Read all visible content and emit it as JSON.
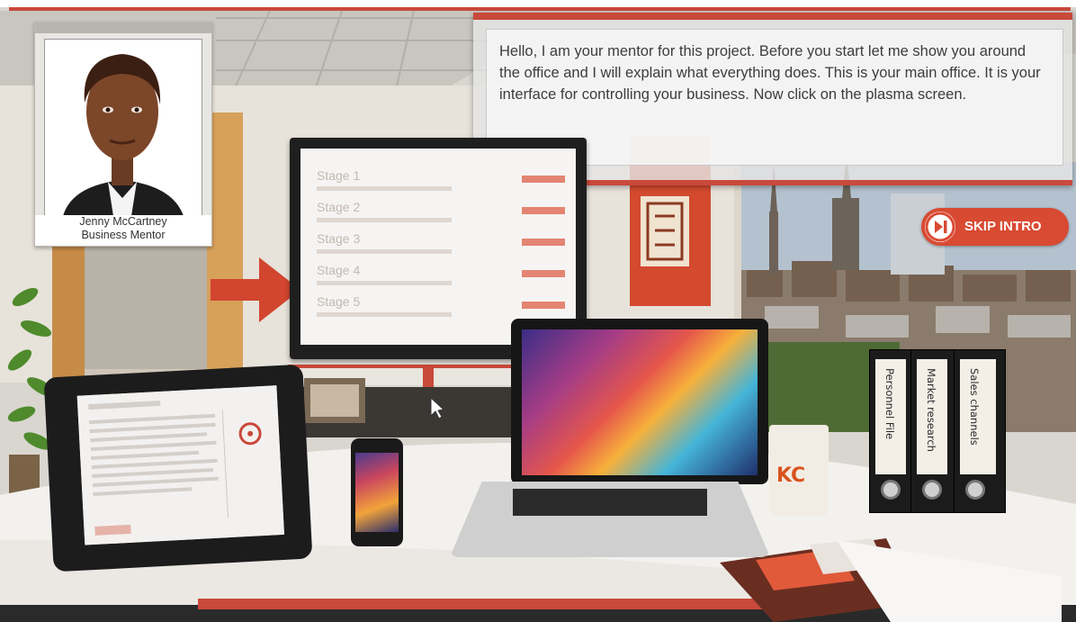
{
  "mentor": {
    "name": "Jenny McCartney",
    "role": "Business Mentor"
  },
  "dialog": {
    "text": "Hello, I am your mentor for this project. Before you start let me show you around the office and I will explain what everything does. This is your main office. It is your interface for controlling your business. Now click on the plasma screen."
  },
  "skip_intro": {
    "label": "SKIP INTRO",
    "icon": "skip-forward-icon"
  },
  "plasma_screen": {
    "stages": [
      {
        "title": "Stage 1"
      },
      {
        "title": "Stage 2"
      },
      {
        "title": "Stage 3"
      },
      {
        "title": "Stage 4"
      },
      {
        "title": "Stage 5"
      }
    ]
  },
  "binders": [
    {
      "label": "Personnel File"
    },
    {
      "label": "Market research"
    },
    {
      "label": "Sales channels"
    }
  ],
  "cup": {
    "logo": "KC"
  },
  "colors": {
    "accent": "#d94a33",
    "dialog_bar": "#c9493b",
    "arrow": "#d2452f"
  }
}
